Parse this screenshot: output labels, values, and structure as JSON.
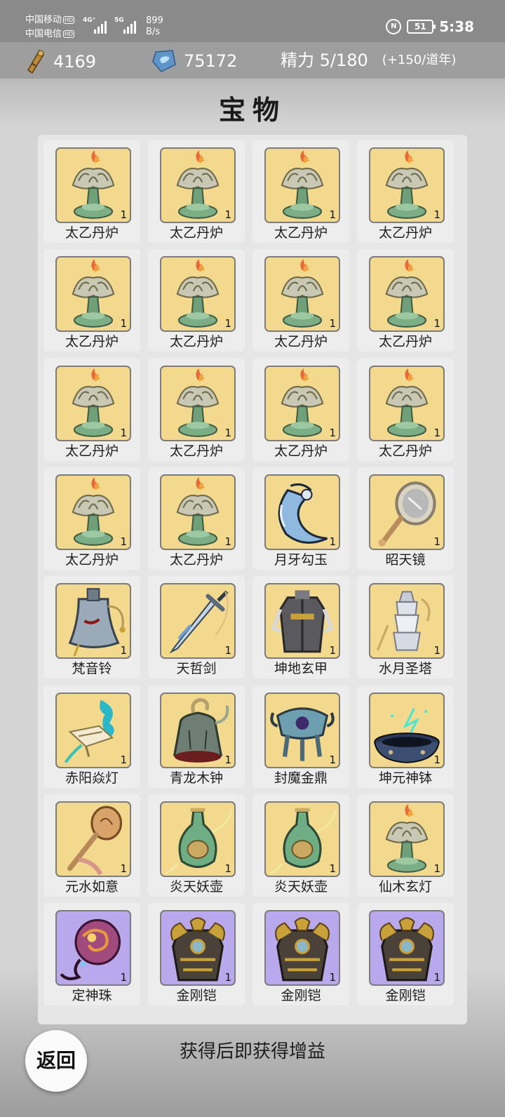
{
  "status_bar": {
    "carrier1": "中国移动",
    "carrier2": "中国电信",
    "hd": "HD",
    "sig1": "4G⁺",
    "sig2": "5G",
    "speed_value": "899",
    "speed_unit": "B/s",
    "nfc": "N",
    "battery": "51",
    "time": "5:38"
  },
  "resources": {
    "scroll": "4169",
    "crystal": "75172",
    "energy": "精力 5/180",
    "energy_regen": "(+150/道年)"
  },
  "title": "宝物",
  "items": [
    {
      "name": "太乙丹炉",
      "qty": "1",
      "art": "lotus-lamp",
      "rarity": "gold"
    },
    {
      "name": "太乙丹炉",
      "qty": "1",
      "art": "lotus-lamp",
      "rarity": "gold"
    },
    {
      "name": "太乙丹炉",
      "qty": "1",
      "art": "lotus-lamp",
      "rarity": "gold"
    },
    {
      "name": "太乙丹炉",
      "qty": "1",
      "art": "lotus-lamp",
      "rarity": "gold"
    },
    {
      "name": "太乙丹炉",
      "qty": "1",
      "art": "lotus-lamp",
      "rarity": "gold"
    },
    {
      "name": "太乙丹炉",
      "qty": "1",
      "art": "lotus-lamp",
      "rarity": "gold"
    },
    {
      "name": "太乙丹炉",
      "qty": "1",
      "art": "lotus-lamp",
      "rarity": "gold"
    },
    {
      "name": "太乙丹炉",
      "qty": "1",
      "art": "lotus-lamp",
      "rarity": "gold"
    },
    {
      "name": "太乙丹炉",
      "qty": "1",
      "art": "lotus-lamp",
      "rarity": "gold"
    },
    {
      "name": "太乙丹炉",
      "qty": "1",
      "art": "lotus-lamp",
      "rarity": "gold"
    },
    {
      "name": "太乙丹炉",
      "qty": "1",
      "art": "lotus-lamp",
      "rarity": "gold"
    },
    {
      "name": "太乙丹炉",
      "qty": "1",
      "art": "lotus-lamp",
      "rarity": "gold"
    },
    {
      "name": "太乙丹炉",
      "qty": "1",
      "art": "lotus-lamp",
      "rarity": "gold"
    },
    {
      "name": "太乙丹炉",
      "qty": "1",
      "art": "lotus-lamp",
      "rarity": "gold"
    },
    {
      "name": "月牙勾玉",
      "qty": "1",
      "art": "crescent-jade",
      "rarity": "gold"
    },
    {
      "name": "昭天镜",
      "qty": "1",
      "art": "mirror",
      "rarity": "gold"
    },
    {
      "name": "梵音铃",
      "qty": "1",
      "art": "bell",
      "rarity": "gold"
    },
    {
      "name": "天哲剑",
      "qty": "1",
      "art": "sword",
      "rarity": "gold"
    },
    {
      "name": "坤地玄甲",
      "qty": "1",
      "art": "robe-armor",
      "rarity": "gold"
    },
    {
      "name": "水月圣塔",
      "qty": "1",
      "art": "tower",
      "rarity": "gold"
    },
    {
      "name": "赤阳焱灯",
      "qty": "1",
      "art": "flame-lamp",
      "rarity": "gold"
    },
    {
      "name": "青龙木钟",
      "qty": "1",
      "art": "dragon-bell",
      "rarity": "gold"
    },
    {
      "name": "封魔金鼎",
      "qty": "1",
      "art": "cauldron",
      "rarity": "gold"
    },
    {
      "name": "坤元神钵",
      "qty": "1",
      "art": "bowl",
      "rarity": "gold"
    },
    {
      "name": "元水如意",
      "qty": "1",
      "art": "ruyi",
      "rarity": "gold"
    },
    {
      "name": "炎天妖壶",
      "qty": "1",
      "art": "vase",
      "rarity": "gold"
    },
    {
      "name": "炎天妖壶",
      "qty": "1",
      "art": "vase",
      "rarity": "gold"
    },
    {
      "name": "仙木玄灯",
      "qty": "1",
      "art": "lotus-lamp",
      "rarity": "gold"
    },
    {
      "name": "定神珠",
      "qty": "1",
      "art": "orb",
      "rarity": "purple"
    },
    {
      "name": "金刚铠",
      "qty": "1",
      "art": "dragon-armor",
      "rarity": "purple"
    },
    {
      "name": "金刚铠",
      "qty": "1",
      "art": "dragon-armor",
      "rarity": "purple"
    },
    {
      "name": "金刚铠",
      "qty": "1",
      "art": "dragon-armor",
      "rarity": "purple"
    }
  ],
  "footer_text": "获得后即获得增益",
  "back_label": "返回"
}
